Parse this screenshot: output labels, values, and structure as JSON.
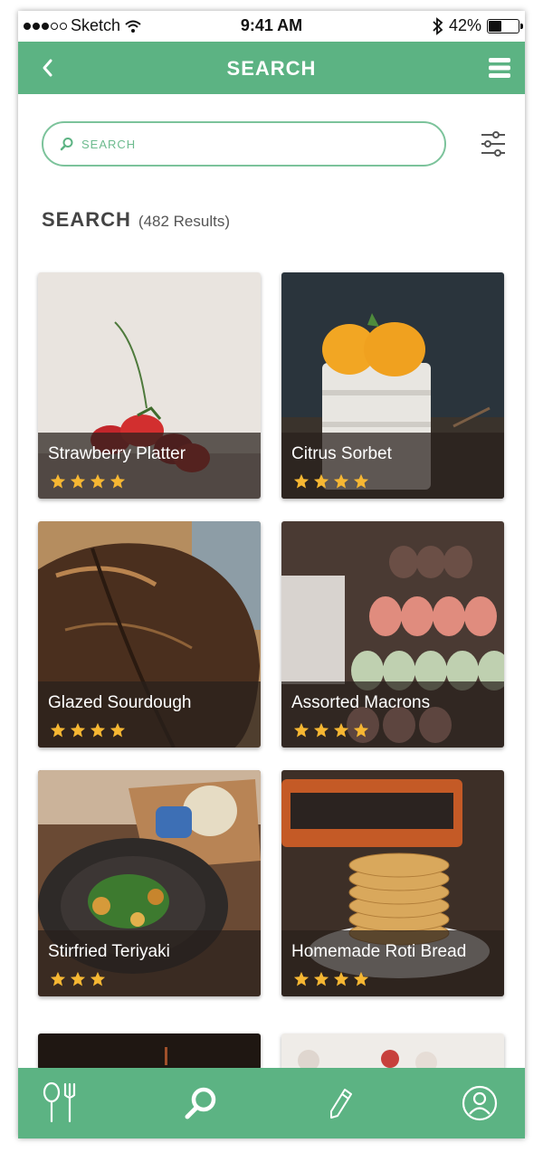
{
  "status_bar": {
    "carrier": "Sketch",
    "time": "9:41 AM",
    "battery_text": "42%",
    "battery_level": 0.42
  },
  "navbar": {
    "title": "SEARCH",
    "back_icon": "chevron-left-icon",
    "menu_icon": "hamburger-menu-icon"
  },
  "search": {
    "placeholder": "SEARCH",
    "value": "",
    "icon": "search-icon",
    "filter_icon": "sliders-icon"
  },
  "results": {
    "title": "SEARCH",
    "count_text": "(482 Results)"
  },
  "cards": [
    {
      "title": "Strawberry Platter",
      "rating": 4
    },
    {
      "title": "Citrus Sorbet",
      "rating": 4
    },
    {
      "title": "Glazed Sourdough",
      "rating": 4
    },
    {
      "title": "Assorted Macrons",
      "rating": 4
    },
    {
      "title": "Stirfried Teriyaki",
      "rating": 3
    },
    {
      "title": "Homemade Roti Bread",
      "rating": 4
    }
  ],
  "tabs": [
    {
      "name": "tab-recipes",
      "icon": "fork-knife-icon"
    },
    {
      "name": "tab-search",
      "icon": "search-icon",
      "active": true
    },
    {
      "name": "tab-write",
      "icon": "pencil-icon"
    },
    {
      "name": "tab-profile",
      "icon": "user-icon"
    }
  ],
  "colors": {
    "brand": "#5cb383",
    "star": "#f6b733",
    "text": "#444444"
  }
}
